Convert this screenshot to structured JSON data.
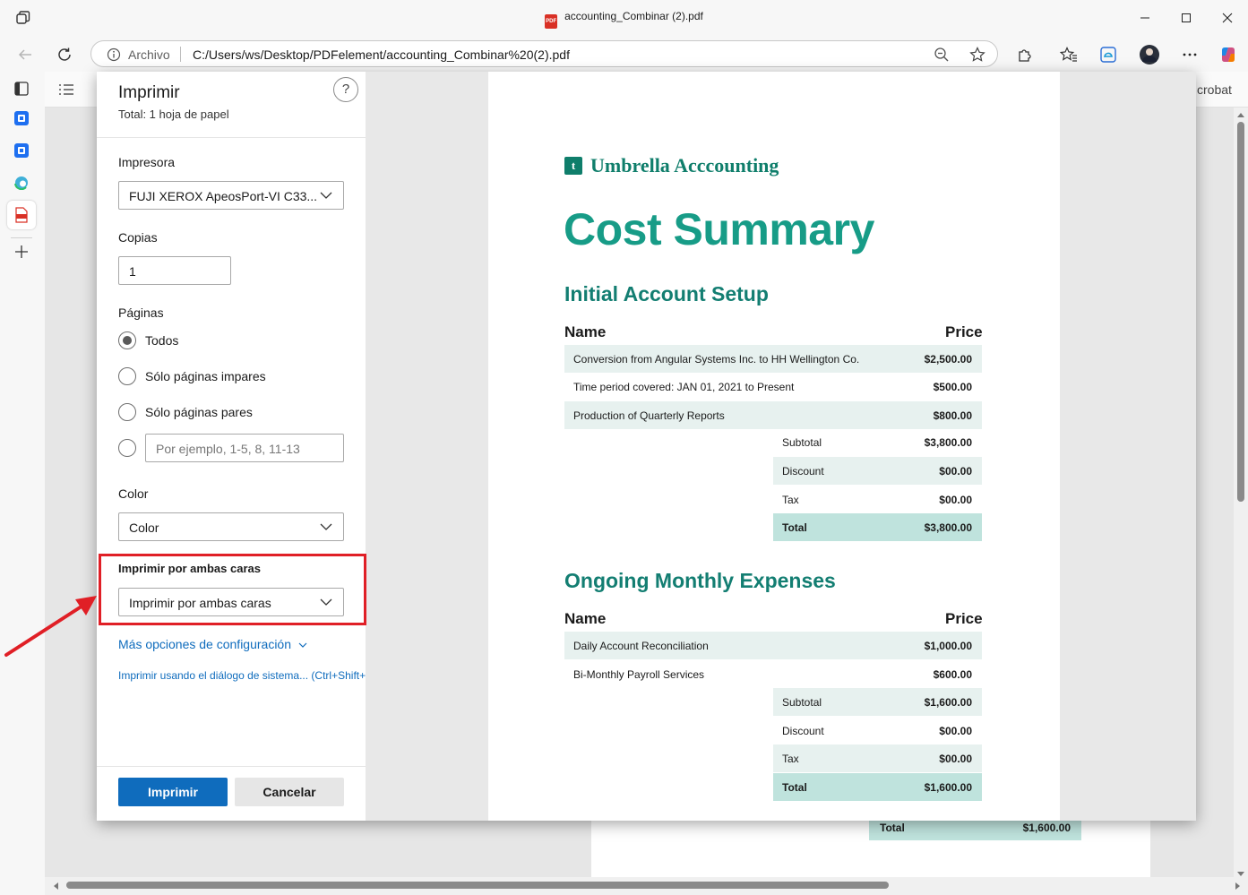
{
  "window": {
    "title": "accounting_Combinar (2).pdf",
    "pdf_badge": "PDF"
  },
  "address": {
    "scheme": "Archivo",
    "url": "C:/Users/ws/Desktop/PDFelement/accounting_Combinar%20(2).pdf"
  },
  "viewer": {
    "acrobat_text": "crobat",
    "bg_total_label": "Total",
    "bg_total_value": "$1,600.00"
  },
  "print": {
    "title": "Imprimir",
    "subtitle": "Total: 1 hoja de papel",
    "help": "?",
    "printer_label": "Impresora",
    "printer_value": "FUJI XEROX ApeosPort-VI C33...",
    "copies_label": "Copias",
    "copies_value": "1",
    "pages_label": "Páginas",
    "pages_options": [
      "Todos",
      "Sólo páginas impares",
      "Sólo páginas pares"
    ],
    "pages_range_placeholder": "Por ejemplo, 1-5, 8, 11-13",
    "color_label": "Color",
    "color_value": "Color",
    "duplex_label": "Imprimir por ambas caras",
    "duplex_value": "Imprimir por ambas caras",
    "more_settings": "Más opciones de configuración",
    "system_dialog": "Imprimir usando el diálogo de sistema... (Ctrl+Shift+",
    "print_button": "Imprimir",
    "cancel_button": "Cancelar"
  },
  "document": {
    "brand": "Umbrella Acccounting",
    "logo_glyph": "t",
    "title": "Cost Summary",
    "section1": {
      "heading": "Initial Account Setup",
      "col_name": "Name",
      "col_price": "Price",
      "rows": [
        {
          "name": "Conversion from Angular Systems Inc. to HH Wellington Co.",
          "price": "$2,500.00"
        },
        {
          "name": "Time period covered: JAN 01, 2021 to Present",
          "price": "$500.00"
        },
        {
          "name": "Production of Quarterly Reports",
          "price": "$800.00"
        }
      ],
      "summary": [
        {
          "name": "Subtotal",
          "price": "$3,800.00"
        },
        {
          "name": "Discount",
          "price": "$00.00"
        },
        {
          "name": "Tax",
          "price": "$00.00"
        },
        {
          "name": "Total",
          "price": "$3,800.00"
        }
      ]
    },
    "section2": {
      "heading": "Ongoing Monthly Expenses",
      "col_name": "Name",
      "col_price": "Price",
      "rows": [
        {
          "name": "Daily Account Reconciliation",
          "price": "$1,000.00"
        },
        {
          "name": "Bi-Monthly Payroll Services",
          "price": "$600.00"
        }
      ],
      "summary": [
        {
          "name": "Subtotal",
          "price": "$1,600.00"
        },
        {
          "name": "Discount",
          "price": "$00.00"
        },
        {
          "name": "Tax",
          "price": "$00.00"
        },
        {
          "name": "Total",
          "price": "$1,600.00"
        }
      ]
    }
  },
  "colors": {
    "accent": "#0f6cbd",
    "brand": "#0f7e6b",
    "annotation": "#e01f26"
  },
  "icons": {
    "tabs": "tab-actions-icon",
    "back": "back-arrow-icon",
    "refresh": "refresh-icon",
    "info": "info-icon",
    "zoom": "zoom-out-icon",
    "favorite": "star-icon",
    "extensions": "puzzle-icon",
    "favorites": "favorites-icon",
    "collections": "browser-essentials-icon",
    "profile": "profile-avatar",
    "more": "more-icon",
    "copilot": "copilot-icon"
  }
}
